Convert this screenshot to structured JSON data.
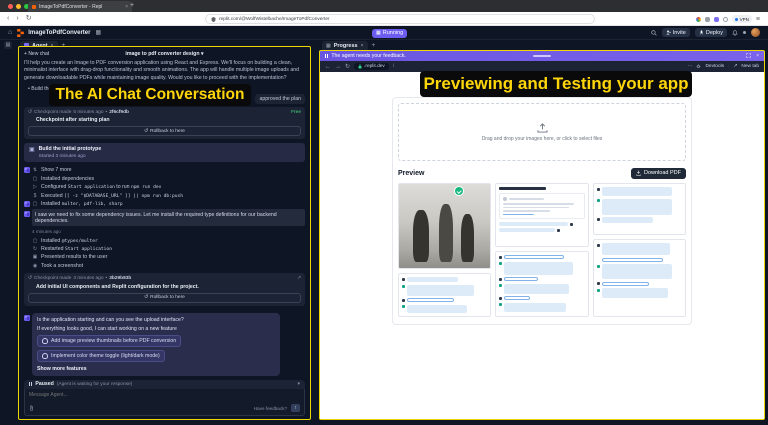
{
  "browser": {
    "tab_title": "ImageToPdfConverter - Repl",
    "url": "replit.com/@WolfWistelbache/ImageToPdfConverter",
    "vpn_label": "VPN"
  },
  "workspace": {
    "project_name": "ImageToPdfConverter",
    "running_label": "Running",
    "invite_label": "Invite",
    "deploy_label": "Deploy",
    "agent_tab": "Agent",
    "progress_tab": "Progress"
  },
  "annotations": {
    "left_title": "The AI Chat Conversation",
    "right_title": "Previewing and Testing your app"
  },
  "agent": {
    "new_chat": "New chat",
    "chat_title": "image to pdf converter design",
    "intro": "I'll help you create an Image to PDF conversion application using React and Express. We'll focus on building a clean, minimalist interface with drag-drop functionality and smooth animations. The app will handle multiple image uploads and generate downloadable PDFs while maintaining image quality. Would you like to proceed with the implementation?",
    "intro_bullet": "Build the initial prototype",
    "user_reply": "approved the plan",
    "checkpoint1": {
      "label": "Checkpoint made",
      "time": "5 minutes ago",
      "hash": "2f6cf9db",
      "badge": "Free",
      "title": "Checkpoint after starting plan",
      "rollback": "Rollback to here"
    },
    "task": {
      "title": "Build the initial prototype",
      "subtitle": "Started 3 minutes ago"
    },
    "rows": [
      {
        "text": "Show 7 more"
      },
      {
        "text": "Installed dependencies"
      },
      {
        "pre": "Configured ",
        "code": "Start application",
        "mid": " to run ",
        "code2": "npm run dev"
      },
      {
        "pre": "Executed ",
        "code": "[[ -z \"$DATABASE_URL\" ]] || npm run db:push"
      },
      {
        "pre": "Installed ",
        "code": "multer, pdf-lib, sharp"
      }
    ],
    "note": "I saw we need to fix some dependency issues. Let me install the required type definitions for our backend dependencies.",
    "note_time": "4 minutes ago",
    "rows2": [
      {
        "pre": "Installed ",
        "code": "@types/multer"
      },
      {
        "pre": "Restarted ",
        "code": "Start application"
      },
      {
        "text": "Presented results to the user"
      },
      {
        "text": "Took a screenshot"
      }
    ],
    "checkpoint2": {
      "label": "Checkpoint made",
      "time": "3 minutes ago",
      "hash": "3b29b83b",
      "title": "Add initial UI components and Replit configuration for the project.",
      "rollback": "Rollback to here"
    },
    "question": {
      "line1": "Is the application starting and can you see the upload interface?",
      "line2": "If everything looks good, I can start working on a new feature",
      "chip1": "Add image preview thumbnails before PDF conversion",
      "chip2": "Implement color theme toggle (light/dark mode)",
      "more": "Show more features"
    },
    "paused_bold": "Paused",
    "paused_rest": "(Agent is waiting for your response)",
    "input_placeholder": "Message Agent...",
    "feedback": "Have feedback?"
  },
  "preview": {
    "banner": "The agent needs your feedback.",
    "host": ".replit.dev",
    "path": "/",
    "devtools": "Devtools",
    "new_tab": "New tab",
    "dropzone": "Drag and drop your images here, or click to select files",
    "heading": "Preview",
    "download": "Download PDF"
  },
  "colors": {
    "annotation_yellow": "#ffd60a",
    "frame_yellow": "#eed702",
    "replit_purple": "#6d5cf0",
    "free_green": "#4ade80",
    "badge_green": "#18b981",
    "download_navy": "#1f2937"
  }
}
